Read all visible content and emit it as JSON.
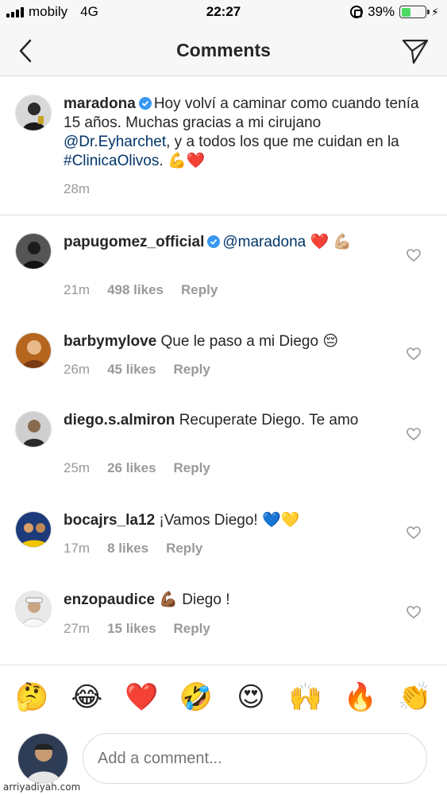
{
  "status_bar": {
    "carrier": "mobily",
    "network": "4G",
    "time": "22:27",
    "battery": "39%",
    "battery_level": 0.39
  },
  "nav": {
    "title": "Comments",
    "back_icon": "chevron-left-icon",
    "send_icon": "paper-plane-icon"
  },
  "caption": {
    "username": "maradona",
    "text_1": "Hoy volví a caminar como cuando tenía 15 años. Muchas gracias a mi cirujano ",
    "mention": "@Dr.Eyharchet",
    "text_2": ", y a todos los que me cuidan en la ",
    "hashtag": "#ClinicaOlivos",
    "text_3": ". ",
    "emoji": "💪❤️",
    "time": "28m"
  },
  "comments": [
    {
      "username": "papugomez_official",
      "verified": true,
      "mention": "@maradona",
      "text": " ❤️ 💪🏼",
      "time": "21m",
      "likes": "498 likes",
      "reply": "Reply"
    },
    {
      "username": "barbymylove",
      "text": " Que le paso a mi Diego 😔",
      "time": "26m",
      "likes": "45 likes",
      "reply": "Reply"
    },
    {
      "username": "diego.s.almiron",
      "text": " Recuperate Diego. Te amo",
      "time": "25m",
      "likes": "26 likes",
      "reply": "Reply"
    },
    {
      "username": "bocajrs_la12",
      "text": " ¡Vamos Diego! 💙💛",
      "time": "17m",
      "likes": "8 likes",
      "reply": "Reply"
    },
    {
      "username": "enzopaudice",
      "text": " 💪🏾 Diego !",
      "time": "27m",
      "likes": "15 likes",
      "reply": "Reply"
    }
  ],
  "emoji_bar": [
    "🤔",
    "😂",
    "❤️",
    "🤣",
    "😍",
    "🙌",
    "🔥",
    "👏"
  ],
  "composer": {
    "placeholder": "Add a comment..."
  },
  "watermark": "arriyadiyah.com",
  "colors": {
    "mention": "#003569",
    "meta": "#999999",
    "verified": "#3897f0",
    "separator": "#dbdbdb"
  }
}
